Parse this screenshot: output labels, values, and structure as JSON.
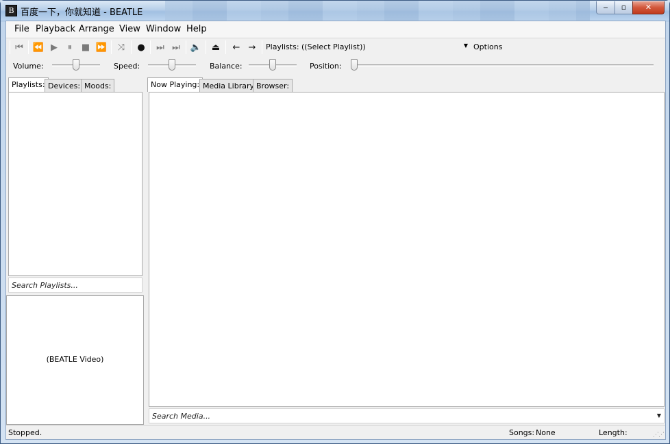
{
  "window": {
    "title": "百度一下，你就知道 - BEATLE",
    "icon_glyph": "B",
    "minimize_glyph": "‒",
    "maximize_glyph": "▫",
    "close_glyph": "✕"
  },
  "menu": {
    "items": [
      "File",
      "Playback",
      "Arrange",
      "View",
      "Window",
      "Help"
    ]
  },
  "toolbar": {
    "buttons": [
      {
        "icon": "skip-start-icon",
        "glyph": "⏮"
      },
      {
        "icon": "rewind-icon",
        "glyph": "⏪"
      },
      {
        "icon": "play-icon",
        "glyph": "▶"
      },
      {
        "icon": "pause-icon",
        "glyph": "⏸"
      },
      {
        "icon": "stop-icon",
        "glyph": "■"
      },
      {
        "icon": "fast-forward-icon",
        "glyph": "⏩"
      },
      {
        "icon": "shuffle-icon",
        "glyph": "⤨"
      },
      {
        "icon": "record-icon",
        "glyph": "●"
      },
      {
        "icon": "next-track-icon",
        "glyph": "⏭"
      },
      {
        "icon": "skip-end-icon",
        "glyph": "⏭"
      },
      {
        "icon": "mute-icon",
        "glyph": "🔈"
      },
      {
        "icon": "eject-icon",
        "glyph": "⏏"
      },
      {
        "icon": "back-arrow-icon",
        "glyph": "←"
      },
      {
        "icon": "forward-arrow-icon",
        "glyph": "→"
      }
    ],
    "playlists_label": "Playlists:",
    "playlist_selected": "((Select Playlist))",
    "options_label": "Options"
  },
  "sliders": {
    "volume_label": "Volume:",
    "speed_label": "Speed:",
    "balance_label": "Balance:",
    "position_label": "Position:",
    "volume_level": 0.5,
    "speed_level": 0.5,
    "balance_level": 0.5,
    "position_level": 0
  },
  "left_panel": {
    "tabs": [
      "Playlists:",
      "Devices:",
      "Moods:"
    ],
    "active_tab": 0,
    "search_placeholder": "Search Playlists...",
    "video_label": "(BEATLE Video)"
  },
  "right_panel": {
    "tabs": [
      "Now Playing:",
      "Media Library:",
      "Browser:"
    ],
    "active_tab": 0,
    "search_placeholder": "Search Media..."
  },
  "status": {
    "text": "Stopped.",
    "songs_label": "Songs:",
    "songs_value": "None",
    "length_label": "Length:"
  }
}
